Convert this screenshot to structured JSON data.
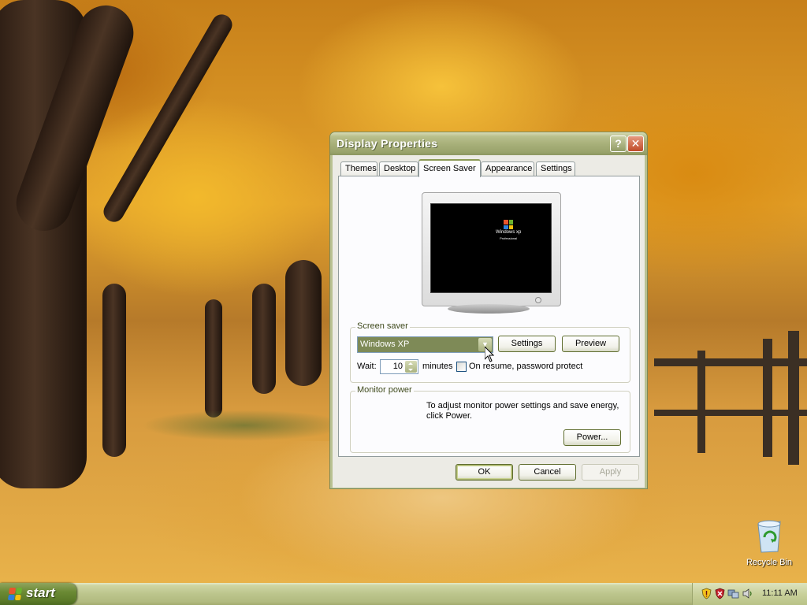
{
  "desktop": {
    "recycle_bin_label": "Recycle Bin"
  },
  "dialog": {
    "title": "Display Properties",
    "help_glyph": "?",
    "close_glyph": "✕",
    "tabs": [
      {
        "label": "Themes",
        "active": false
      },
      {
        "label": "Desktop",
        "active": false
      },
      {
        "label": "Screen Saver",
        "active": true
      },
      {
        "label": "Appearance",
        "active": false
      },
      {
        "label": "Settings",
        "active": false
      }
    ],
    "preview_logo_text": "Windows xp",
    "preview_logo_sub": "Professional",
    "screen_saver": {
      "legend": "Screen saver",
      "selected": "Windows XP",
      "settings_label": "Settings",
      "preview_label": "Preview",
      "wait_label": "Wait:",
      "wait_value": "10",
      "minutes_label": "minutes",
      "password_protect_label": "On resume, password protect",
      "password_protect_checked": false
    },
    "monitor_power": {
      "legend": "Monitor power",
      "description": "To adjust monitor power settings and save energy, click Power.",
      "power_label": "Power..."
    },
    "buttons": {
      "ok": "OK",
      "cancel": "Cancel",
      "apply": "Apply"
    }
  },
  "taskbar": {
    "start_label": "start",
    "clock": "11:11 AM",
    "tray_icons": [
      "security-shield-icon",
      "antivirus-icon",
      "network-icon",
      "volume-icon"
    ]
  },
  "colors": {
    "title_bar": "#a8b07a",
    "accent_olive": "#7e8a57",
    "start_green": "#6b8a34"
  }
}
